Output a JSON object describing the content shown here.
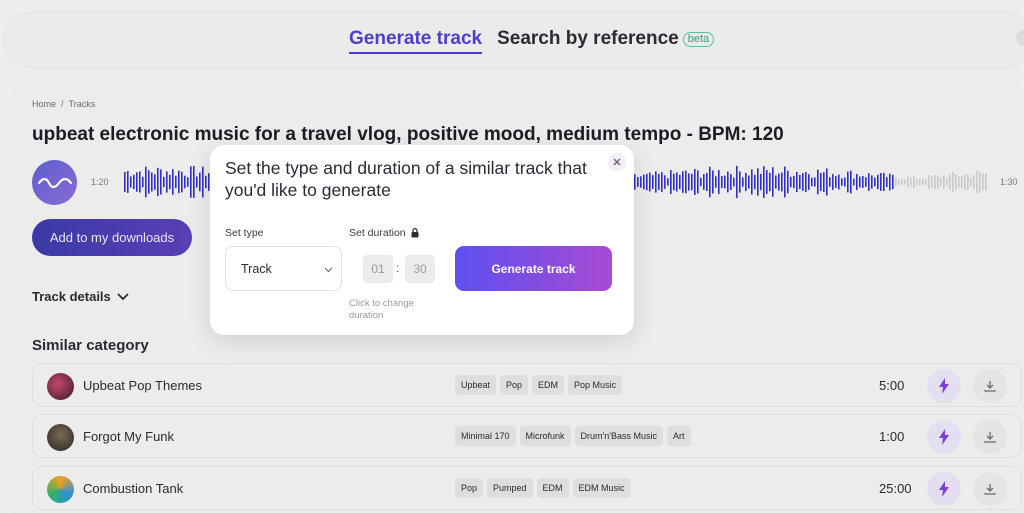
{
  "nav": {
    "tabs": [
      {
        "label": "Generate track",
        "active": true
      },
      {
        "label": "Search by reference",
        "active": false,
        "badge": "beta"
      }
    ]
  },
  "breadcrumb": [
    "Home",
    "/",
    "Tracks"
  ],
  "track": {
    "title": "upbeat electronic music for a travel vlog, positive mood, medium tempo - BPM: 120",
    "time_current": "1:20",
    "time_total": "1:30",
    "progress": 0.89
  },
  "actions": {
    "add_downloads": "Add to my downloads",
    "track_details": "Track details"
  },
  "similar": {
    "title": "Similar category",
    "rows": [
      {
        "name": "Upbeat Pop Themes",
        "tags": [
          "Upbeat",
          "Pop",
          "EDM",
          "Pop Music"
        ],
        "duration": "5:00"
      },
      {
        "name": "Forgot My Funk",
        "tags": [
          "Minimal 170",
          "Microfunk",
          "Drum'n'Bass Music",
          "Art"
        ],
        "duration": "1:00"
      },
      {
        "name": "Combustion Tank",
        "tags": [
          "Pop",
          "Pumped",
          "EDM",
          "EDM Music"
        ],
        "duration": "25:00"
      }
    ]
  },
  "modal": {
    "title": "Set the type and duration of a similar track that you'd like to generate",
    "type_label": "Set type",
    "type_value": "Track",
    "duration_label": "Set duration",
    "minutes": "01",
    "seconds": "30",
    "hint": "Click to change duration",
    "generate_label": "Generate track"
  },
  "colors": {
    "accent": "#4c3fcf",
    "waveform_played": "#2f2fc4",
    "gradient_start": "#5d50f0",
    "gradient_end": "#a74bd2"
  }
}
